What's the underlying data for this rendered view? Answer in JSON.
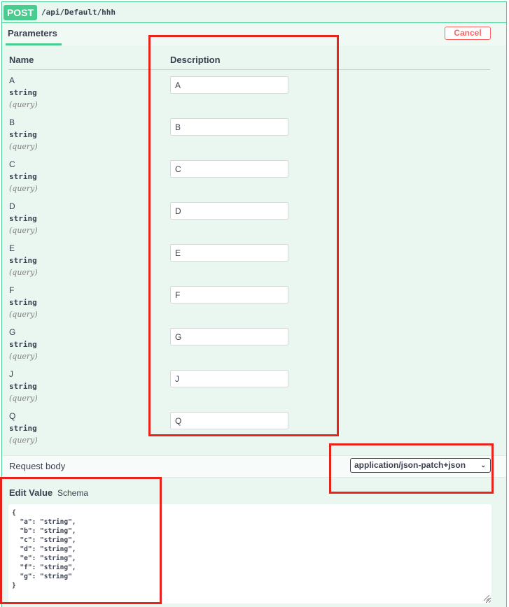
{
  "operation": {
    "method": "POST",
    "path": "/api/Default/hhh"
  },
  "section": {
    "tab_label": "Parameters",
    "cancel_label": "Cancel"
  },
  "table": {
    "col_name": "Name",
    "col_description": "Description"
  },
  "params": [
    {
      "name": "A",
      "type": "string",
      "in": "(query)",
      "value": "A"
    },
    {
      "name": "B",
      "type": "string",
      "in": "(query)",
      "value": "B"
    },
    {
      "name": "C",
      "type": "string",
      "in": "(query)",
      "value": "C"
    },
    {
      "name": "D",
      "type": "string",
      "in": "(query)",
      "value": "D"
    },
    {
      "name": "E",
      "type": "string",
      "in": "(query)",
      "value": "E"
    },
    {
      "name": "F",
      "type": "string",
      "in": "(query)",
      "value": "F"
    },
    {
      "name": "G",
      "type": "string",
      "in": "(query)",
      "value": "G"
    },
    {
      "name": "J",
      "type": "string",
      "in": "(query)",
      "value": "J"
    },
    {
      "name": "Q",
      "type": "string",
      "in": "(query)",
      "value": "Q"
    }
  ],
  "request_body": {
    "label": "Request body",
    "content_type": "application/json-patch+json",
    "tab_edit": "Edit Value",
    "tab_schema": "Schema",
    "value": "{\n  \"a\": \"string\",\n  \"b\": \"string\",\n  \"c\": \"string\",\n  \"d\": \"string\",\n  \"e\": \"string\",\n  \"f\": \"string\",\n  \"g\": \"string\"\n}"
  },
  "icons": {
    "select_chevron": "chevron-down-icon",
    "resize_grip": "resize-grip-icon"
  },
  "colors": {
    "post_green": "#49cc90",
    "panel_bg": "#eaf6f0",
    "cancel_red": "#ff6060",
    "annotation_red": "#e8231c"
  }
}
